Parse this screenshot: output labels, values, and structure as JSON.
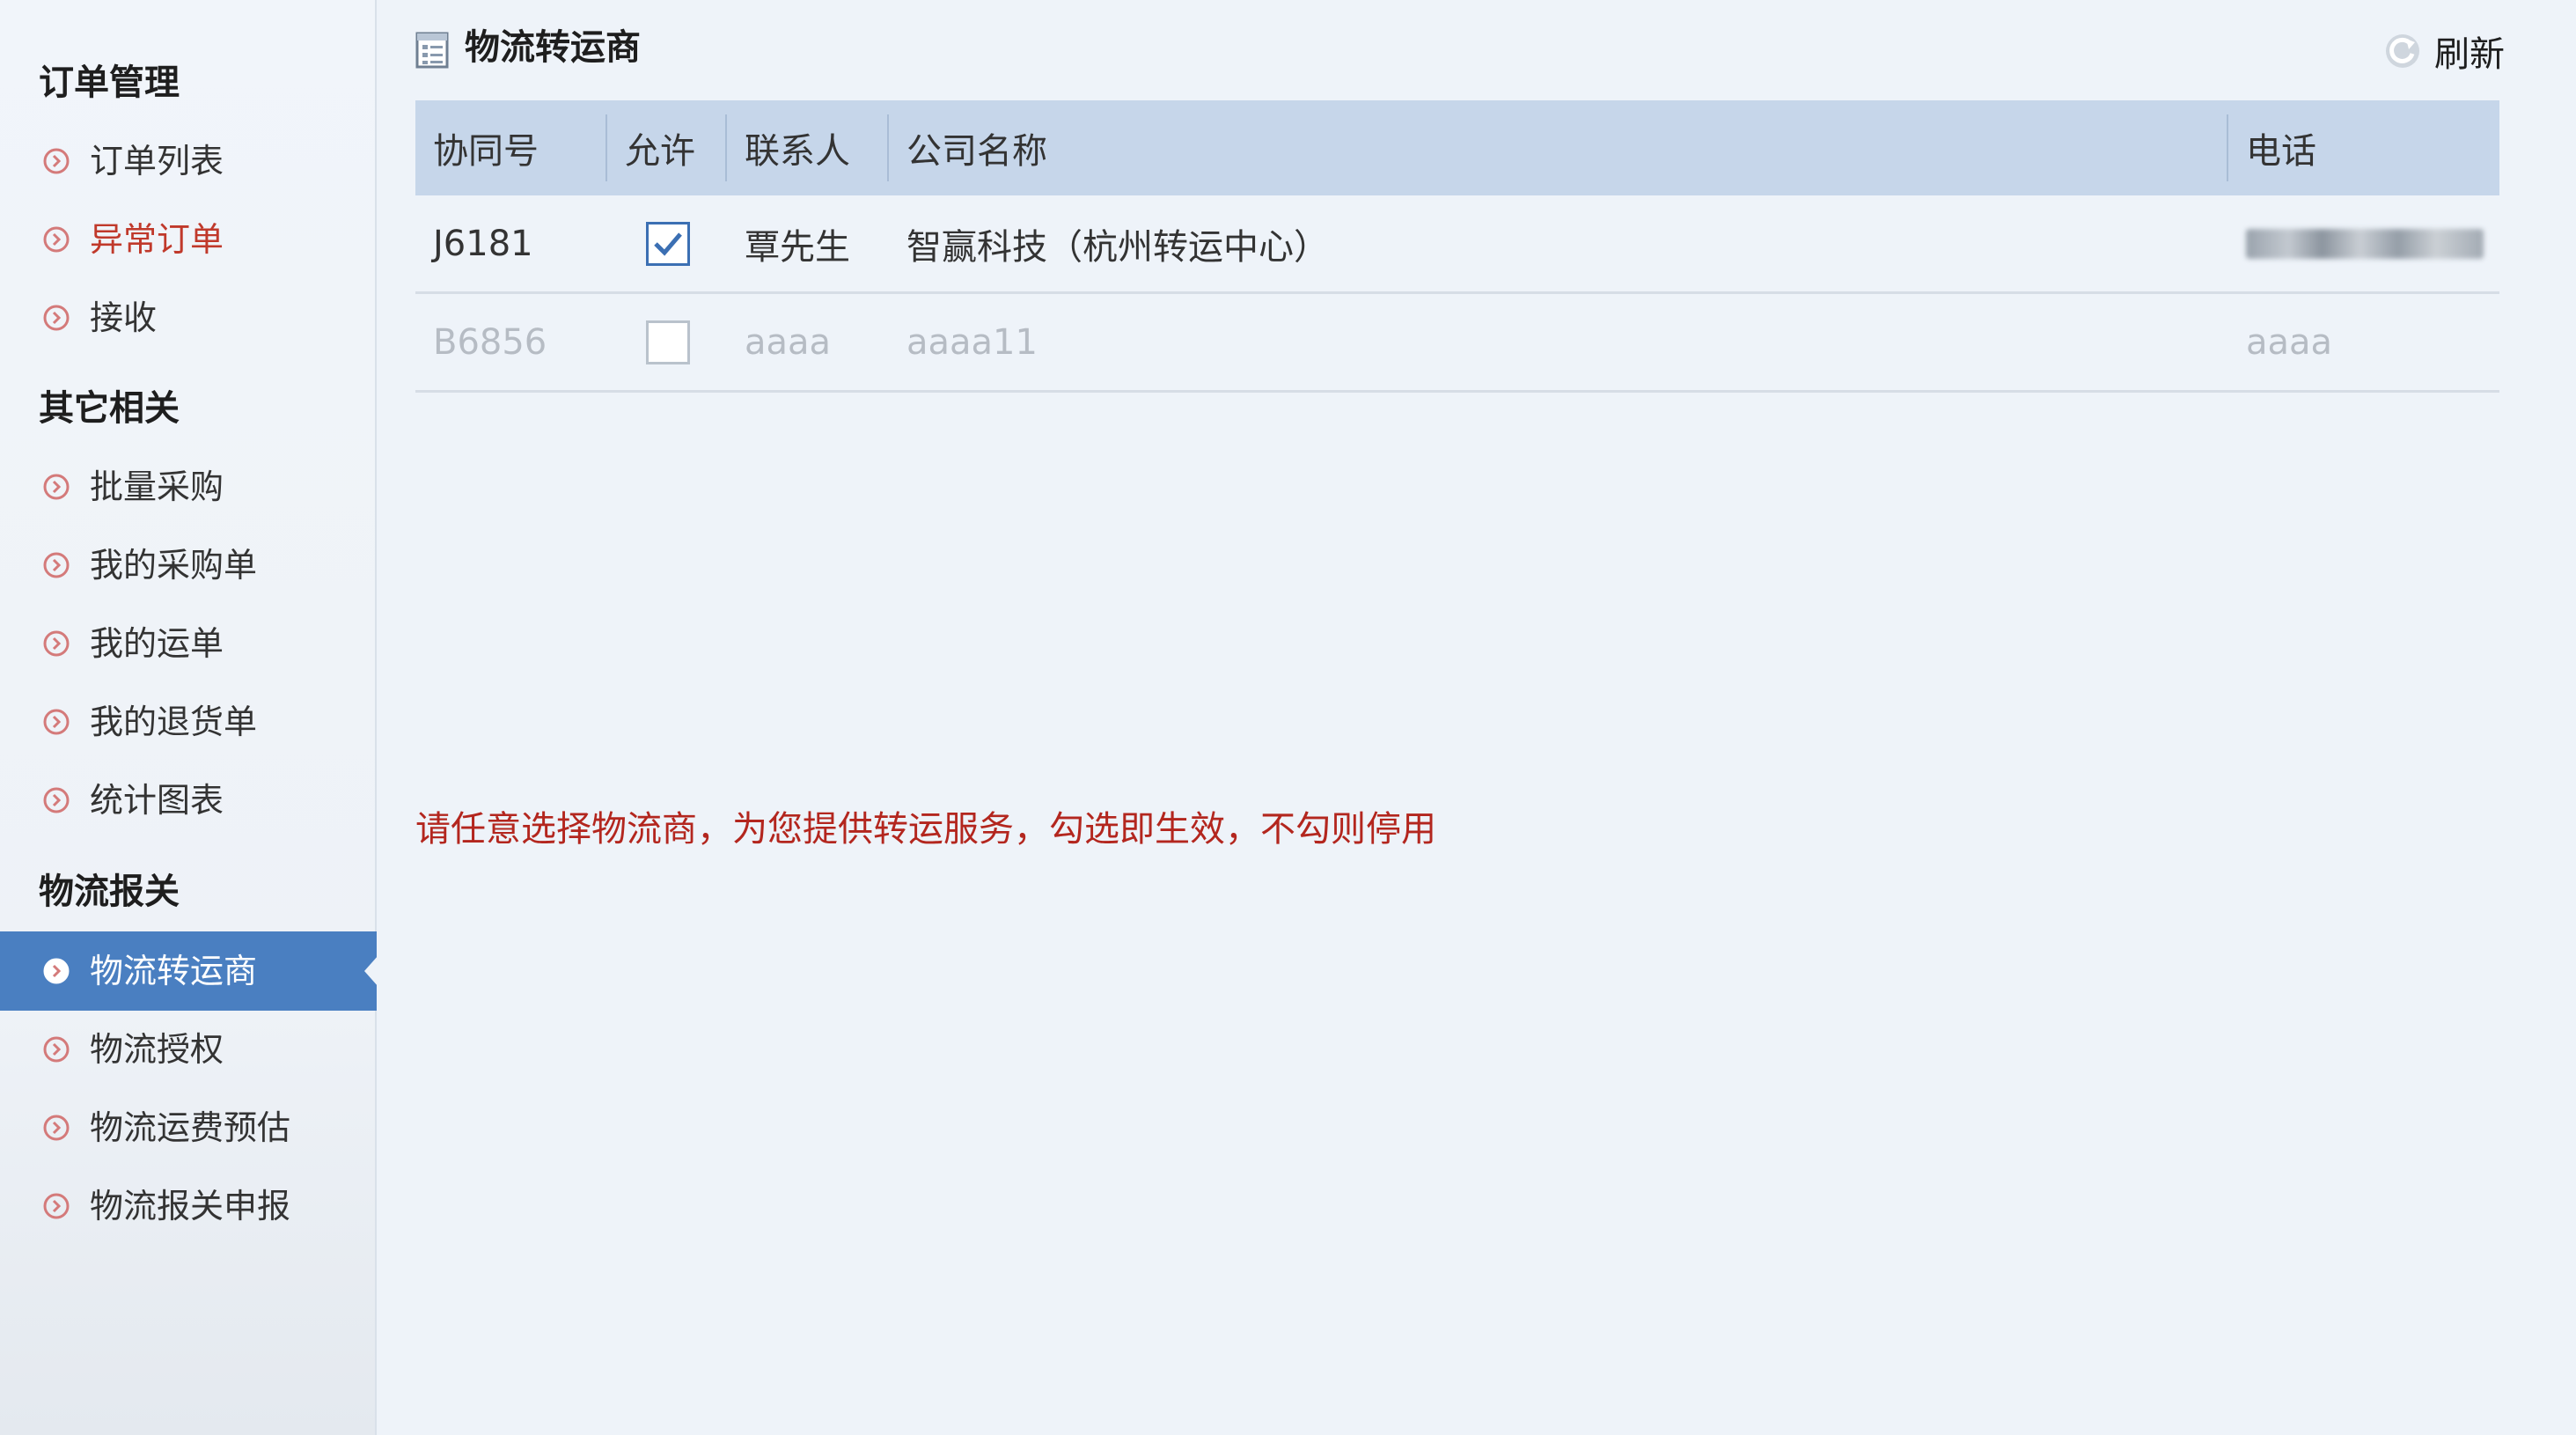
{
  "sidebar": {
    "sections": [
      {
        "title": "订单管理",
        "items": [
          {
            "label": "订单列表",
            "state": "normal"
          },
          {
            "label": "异常订单",
            "state": "warn"
          },
          {
            "label": "接收",
            "state": "normal"
          }
        ]
      },
      {
        "title": "其它相关",
        "items": [
          {
            "label": "批量采购",
            "state": "normal"
          },
          {
            "label": "我的采购单",
            "state": "normal"
          },
          {
            "label": "我的运单",
            "state": "normal"
          },
          {
            "label": "我的退货单",
            "state": "normal"
          },
          {
            "label": "统计图表",
            "state": "normal"
          }
        ]
      },
      {
        "title": "物流报关",
        "items": [
          {
            "label": "物流转运商",
            "state": "active"
          },
          {
            "label": "物流授权",
            "state": "normal"
          },
          {
            "label": "物流运费预估",
            "state": "normal"
          },
          {
            "label": "物流报关申报",
            "state": "normal"
          }
        ]
      }
    ]
  },
  "header": {
    "title": "物流转运商",
    "refresh_label": "刷新"
  },
  "table": {
    "columns": [
      "协同号",
      "允许",
      "联系人",
      "公司名称",
      "电话"
    ],
    "rows": [
      {
        "id": "J6181",
        "allowed": true,
        "contact": "覃先生",
        "company": "智赢科技（杭州转运中心）",
        "phone": "",
        "phone_redacted": true,
        "disabled": false
      },
      {
        "id": "B6856",
        "allowed": false,
        "contact": "aaaa",
        "company": "aaaa11",
        "phone": "aaaa",
        "phone_redacted": false,
        "disabled": true
      }
    ]
  },
  "notice": "请任意选择物流商，为您提供转运服务，勾选即生效，不勾则停用",
  "colors": {
    "active_nav": "#4a7fc1",
    "warn_text": "#c0392b",
    "notice_text": "#b3261e",
    "table_header": "#c6d6ea",
    "checkbox_checked": "#3b6fb3",
    "background": "#eef3f9"
  },
  "icons": {
    "nav_item": "circle-chevron-right-icon",
    "title": "list-document-icon",
    "refresh": "refresh-icon",
    "check": "checkmark-icon"
  }
}
